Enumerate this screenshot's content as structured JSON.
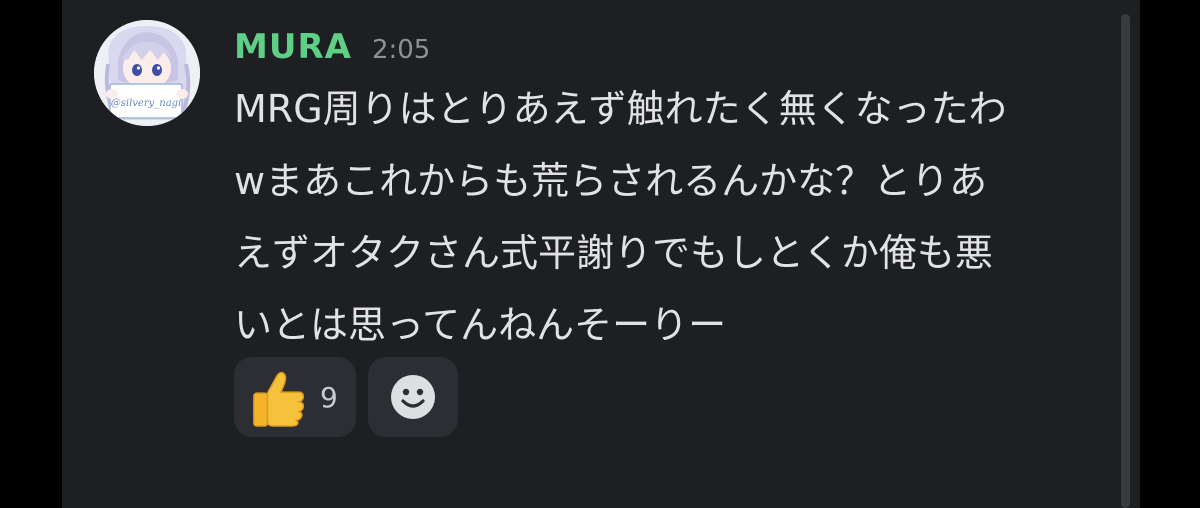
{
  "message": {
    "username": "MURA",
    "timestamp": "2:05",
    "lines": [
      "MRG周りはとりあえず触れたく無くなったわ",
      "wまあこれからも荒らされるんかな？とりあ",
      "えずオタクさん式平謝りでもしとくか俺も悪",
      "いとは思ってんねんそーりー"
    ],
    "avatar": {
      "description_icon": "anime-avatar-icon",
      "sign_text": "@silvery_nagi"
    },
    "reactions": [
      {
        "emoji_icon": "thumbs-up-icon",
        "count": "9"
      },
      {
        "emoji_icon": "add-reaction-smiley-icon"
      }
    ]
  },
  "colors": {
    "background": "#1e1f23",
    "outer": "#000000",
    "username": "#5fce86",
    "text": "#e1e2e6",
    "timestamp": "#8e9096",
    "reaction_bg": "#2c2e34"
  }
}
